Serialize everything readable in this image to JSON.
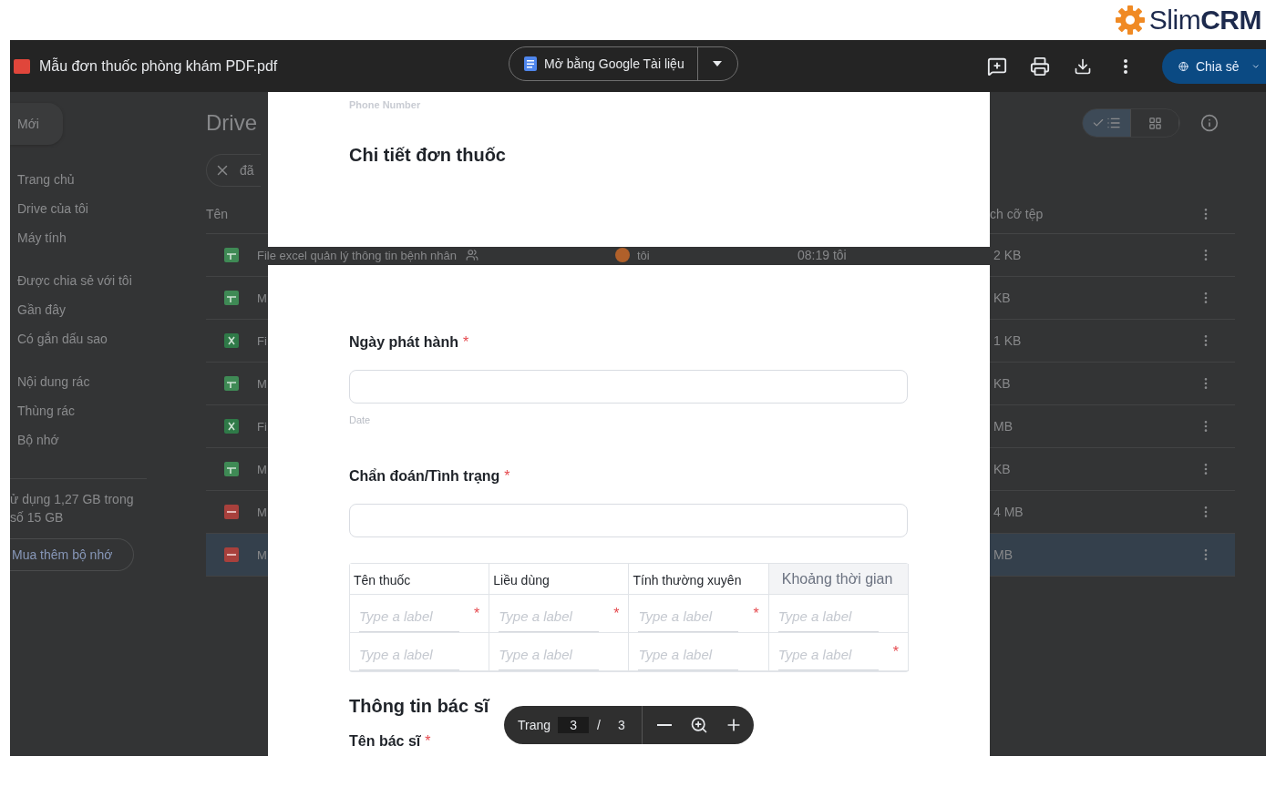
{
  "brand": {
    "logo_text": "Slim**CRM**"
  },
  "viewer": {
    "file_title": "Mẫu đơn thuốc phòng khám PDF.pdf",
    "open_with_button": "Mở bằng Google Tài liệu",
    "share_button": "Chia sẻ"
  },
  "drive": {
    "new_button": "Mới",
    "nav_groups": [
      {
        "items": [
          "Trang chủ",
          "Drive của tôi",
          "Máy tính"
        ]
      },
      {
        "items": [
          "Được chia sẻ với tôi",
          "Gần đây",
          "Có gắn dấu sao"
        ]
      },
      {
        "items": [
          "Nội dung rác",
          "Thùng rác",
          "Bộ nhớ"
        ]
      }
    ],
    "storage_text": "ử dụng 1,27 GB trong số 15 GB",
    "buy_storage_button": "Mua thêm bộ nhớ",
    "title": "Drive",
    "search_chip": "đã",
    "view_options": [
      {
        "kind": "list",
        "selected": true
      },
      {
        "kind": "grid",
        "selected": false
      }
    ],
    "columns": {
      "name": "Tên",
      "size": "ch cỡ tệp"
    },
    "rows": [
      {
        "kind": "sheet",
        "name": "File excel quản lý thông tin bệnh nhân",
        "shared": true,
        "owner": "tôi",
        "modified": "08:19 tôi",
        "size": "2 KB",
        "selected": false
      },
      {
        "kind": "sheet",
        "name": "M",
        "size": "KB",
        "selected": false
      },
      {
        "kind": "excel",
        "name": "Fi",
        "size": "1 KB",
        "selected": false
      },
      {
        "kind": "sheet",
        "name": "M",
        "size": "KB",
        "selected": false
      },
      {
        "kind": "excel",
        "name": "Fi",
        "size": "MB",
        "selected": false
      },
      {
        "kind": "sheet",
        "name": "M",
        "size": "KB",
        "selected": false
      },
      {
        "kind": "pdf",
        "name": "M",
        "size": "4 MB",
        "selected": false
      },
      {
        "kind": "pdf",
        "name": "M",
        "size": "MB",
        "selected": true
      }
    ]
  },
  "pages": [
    {
      "field_hint": "Phone Number",
      "section_title": "Chi tiết đơn thuốc"
    },
    {
      "fields": [
        {
          "label": "Ngày phát hành",
          "required_mark": "*",
          "hint": "Date"
        },
        {
          "label": "Chẩn đoán/Tình trạng",
          "required_mark": "*"
        }
      ],
      "table": {
        "columns": [
          {
            "label": "Tên thuốc",
            "highlighted": false
          },
          {
            "label": "Liều dùng",
            "highlighted": false
          },
          {
            "label": "Tính thường xuyên",
            "highlighted": false
          },
          {
            "label": "Khoảng thời gian",
            "highlighted": true
          }
        ],
        "rows": [
          [
            {
              "placeholder": "Type a label",
              "required_mark": "*"
            },
            {
              "placeholder": "Type a label",
              "required_mark": "*"
            },
            {
              "placeholder": "Type a label",
              "required_mark": "*"
            },
            {
              "placeholder": "Type a label"
            }
          ],
          [
            {
              "placeholder": "Type a label"
            },
            {
              "placeholder": "Type a label"
            },
            {
              "placeholder": "Type a label"
            },
            {
              "placeholder": "Type a label",
              "required_mark": "*"
            }
          ]
        ]
      },
      "section_title": "Thông tin bác sĩ",
      "next_field": {
        "label": "Tên bác sĩ",
        "required_mark": "*"
      }
    }
  ],
  "page_nav": {
    "label": "Trang",
    "current": "3",
    "separator": "/",
    "total": "3"
  }
}
